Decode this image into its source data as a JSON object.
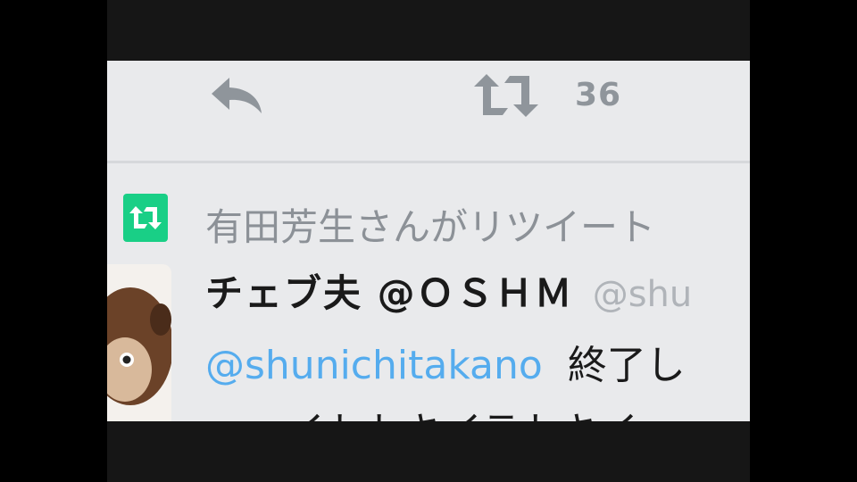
{
  "actions": {
    "retweet_count": "36"
  },
  "tweet": {
    "retweet_context": "有田芳生さんがリツイート",
    "display_name": "チェブ夫 @ＯＳＨＭ",
    "handle": "@shu",
    "mention": "@shunichitakano",
    "text_fragment": "終了し",
    "text_line2_fragment": "イトトキイテトキイ"
  },
  "colors": {
    "retweet_badge": "#19cf86",
    "mention": "#55acee",
    "icon_gray": "#8f959b",
    "background": "#e9eaec"
  },
  "icons": [
    "reply-icon",
    "retweet-icon",
    "retweet-badge-icon"
  ]
}
